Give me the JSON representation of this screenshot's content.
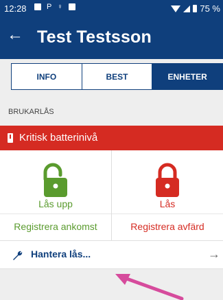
{
  "status_bar": {
    "time": "12:28",
    "battery_text": "75 %"
  },
  "header": {
    "title": "Test Testsson",
    "back_icon": "arrow-left-icon"
  },
  "tabs": [
    {
      "label": "INFO",
      "active": false
    },
    {
      "label": "BEST",
      "active": false
    },
    {
      "label": "ENHETER",
      "active": true
    }
  ],
  "section": {
    "label": "BRUKARLÅS"
  },
  "alert": {
    "text": "Kritisk batterinivå",
    "icon": "battery-icon",
    "color": "#d52b22"
  },
  "actions": {
    "unlock_label": "Lås upp",
    "lock_label": "Lås",
    "register_arrival": "Registrera ankomst",
    "register_departure": "Registrera avfärd",
    "unlock_color": "#5a9b2e",
    "lock_color": "#d52b22"
  },
  "manage": {
    "label": "Hantera lås...",
    "icon": "wrench-icon",
    "arrow": "→"
  },
  "colors": {
    "brand": "#0f3f7c",
    "annotation_arrow": "#d64b9c"
  }
}
